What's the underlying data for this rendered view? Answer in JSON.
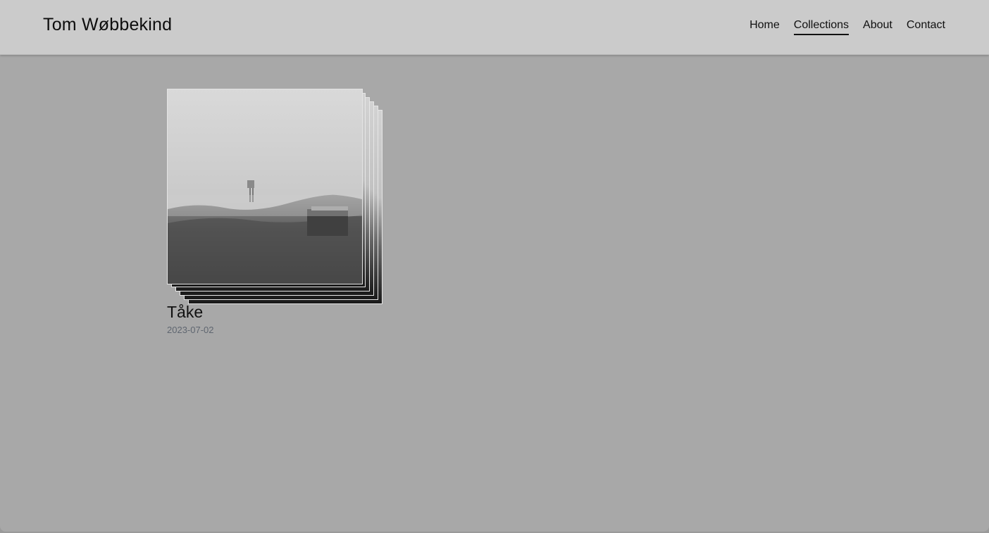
{
  "header": {
    "site_title": "Tom Wøbbekind",
    "nav": [
      {
        "label": "Home",
        "active": false
      },
      {
        "label": "Collections",
        "active": true
      },
      {
        "label": "About",
        "active": false
      },
      {
        "label": "Contact",
        "active": false
      }
    ]
  },
  "collections": [
    {
      "title": "Tåke",
      "date": "2023-07-02"
    }
  ],
  "colors": {
    "header_bg": "#cbcbcb",
    "page_bg": "#a8a8a8",
    "text": "#111111",
    "date_text": "#5f6670"
  }
}
